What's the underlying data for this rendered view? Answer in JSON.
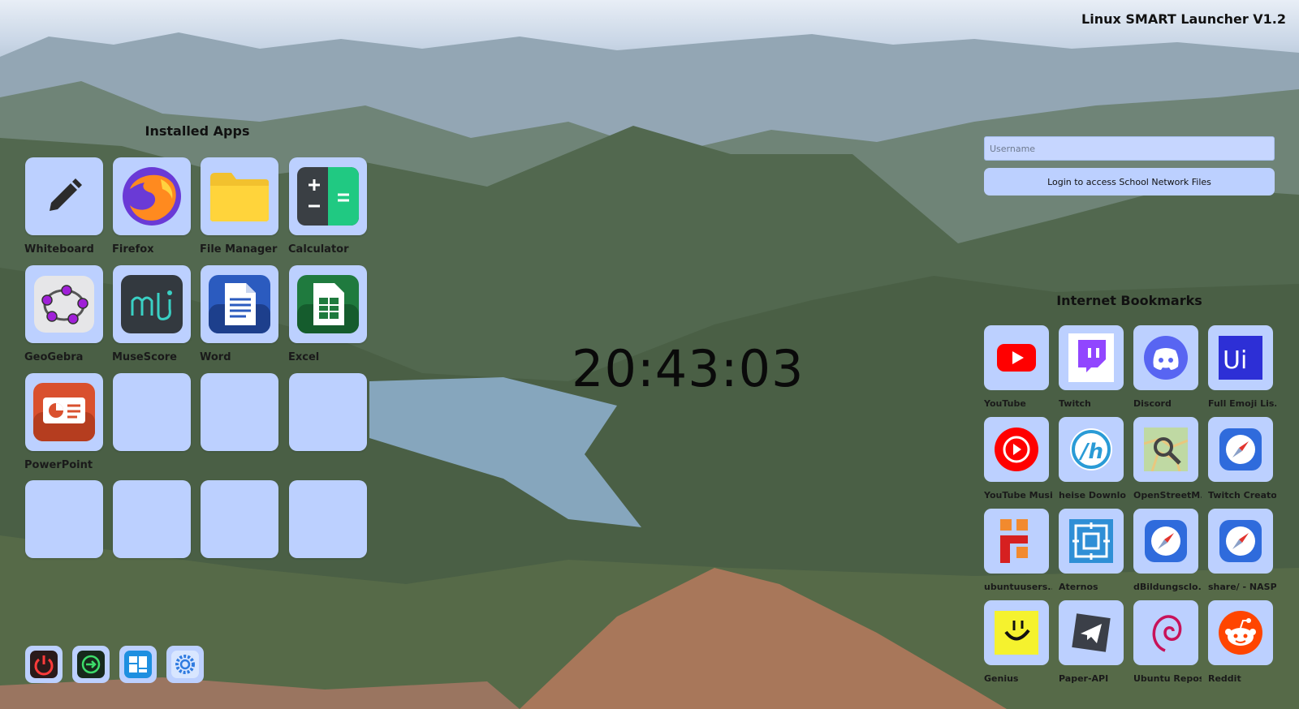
{
  "window": {
    "title": "Linux SMART Launcher V1.2"
  },
  "installed_apps": {
    "heading": "Installed Apps",
    "apps": [
      {
        "label": "Whiteboard",
        "icon": "pencil-icon"
      },
      {
        "label": "Firefox",
        "icon": "firefox-icon"
      },
      {
        "label": "File Manager",
        "icon": "folder-icon"
      },
      {
        "label": "Calculator",
        "icon": "calculator-icon"
      },
      {
        "label": "GeoGebra",
        "icon": "geogebra-icon"
      },
      {
        "label": "MuseScore",
        "icon": "musescore-icon"
      },
      {
        "label": "Word",
        "icon": "word-document-icon"
      },
      {
        "label": "Excel",
        "icon": "spreadsheet-icon"
      },
      {
        "label": "PowerPoint",
        "icon": "presentation-icon"
      }
    ]
  },
  "clock": {
    "time": "20:43:03"
  },
  "login": {
    "username_placeholder": "Username",
    "button_label": "Login to access School Network Files"
  },
  "bookmarks": {
    "heading": "Internet Bookmarks",
    "items": [
      {
        "label": "YouTube",
        "icon": "youtube-icon"
      },
      {
        "label": "Twitch",
        "icon": "twitch-icon"
      },
      {
        "label": "Discord",
        "icon": "discord-icon"
      },
      {
        "label": "Full Emoji Lis...",
        "icon": "unicode-icon"
      },
      {
        "label": "YouTube Music",
        "icon": "youtube-music-icon"
      },
      {
        "label": "heise Downlo...",
        "icon": "heise-icon"
      },
      {
        "label": "OpenStreetM...",
        "icon": "openstreetmap-icon"
      },
      {
        "label": "Twitch Creato...",
        "icon": "compass-icon"
      },
      {
        "label": "ubuntuusers....",
        "icon": "ubuntuusers-icon"
      },
      {
        "label": "Aternos",
        "icon": "aternos-icon"
      },
      {
        "label": "dBildungsclo...",
        "icon": "compass-icon"
      },
      {
        "label": "share/ - NASPI",
        "icon": "compass-icon"
      },
      {
        "label": "Genius",
        "icon": "genius-icon"
      },
      {
        "label": "Paper-API",
        "icon": "paper-plane-icon"
      },
      {
        "label": "Ubuntu Repos",
        "icon": "debian-swirl-icon"
      },
      {
        "label": "Reddit",
        "icon": "reddit-icon"
      }
    ]
  },
  "dock": [
    "power-icon",
    "logout-icon",
    "apps-grid-icon",
    "settings-icon"
  ],
  "colors": {
    "tile": "#bcd0ff",
    "accent_red": "#ff0000",
    "twitch": "#9146ff",
    "discord": "#5865f2"
  }
}
